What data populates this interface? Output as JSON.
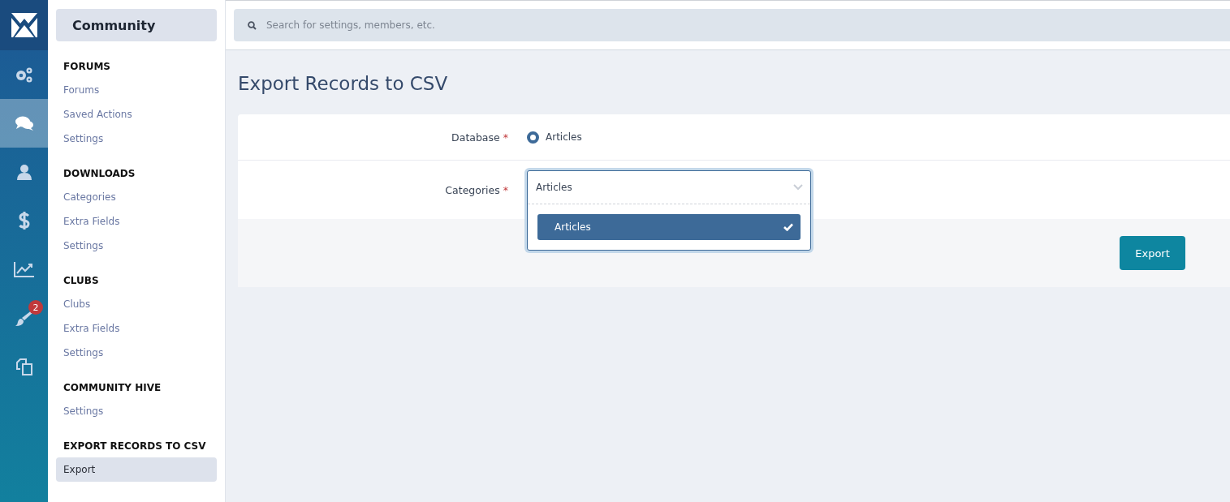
{
  "rail": {
    "items": [
      {
        "kind": "gears",
        "selected": false
      },
      {
        "kind": "chat",
        "selected": true
      },
      {
        "kind": "user",
        "selected": false
      },
      {
        "kind": "dollar",
        "selected": false
      },
      {
        "kind": "chart",
        "selected": false
      },
      {
        "kind": "brush",
        "selected": false,
        "badge": "2"
      },
      {
        "kind": "copy",
        "selected": false
      }
    ]
  },
  "sidebar": {
    "title": "Community",
    "sections": [
      {
        "heading": "FORUMS",
        "items": [
          {
            "label": "Forums",
            "selected": false
          },
          {
            "label": "Saved Actions",
            "selected": false
          },
          {
            "label": "Settings",
            "selected": false
          }
        ]
      },
      {
        "heading": "DOWNLOADS",
        "items": [
          {
            "label": "Categories",
            "selected": false
          },
          {
            "label": "Extra Fields",
            "selected": false
          },
          {
            "label": "Settings",
            "selected": false
          }
        ]
      },
      {
        "heading": "CLUBS",
        "items": [
          {
            "label": "Clubs",
            "selected": false
          },
          {
            "label": "Extra Fields",
            "selected": false
          },
          {
            "label": "Settings",
            "selected": false
          }
        ]
      },
      {
        "heading": "COMMUNITY HIVE",
        "items": [
          {
            "label": "Settings",
            "selected": false
          }
        ]
      },
      {
        "heading": "EXPORT RECORDS TO CSV",
        "items": [
          {
            "label": "Export",
            "selected": true
          }
        ]
      }
    ]
  },
  "search": {
    "placeholder": "Search for settings, members, etc."
  },
  "page_title": "Export Records to CSV",
  "form": {
    "fields": [
      {
        "kind": "radio",
        "label": "Database",
        "required_mark": "*",
        "options": [
          {
            "label": "Articles",
            "selected": true
          }
        ]
      },
      {
        "kind": "select",
        "label": "Categories",
        "required_mark": "*",
        "value": "Articles",
        "expanded": true,
        "options": [
          {
            "label": "Articles",
            "selected": true
          }
        ]
      }
    ],
    "button": "Export"
  }
}
